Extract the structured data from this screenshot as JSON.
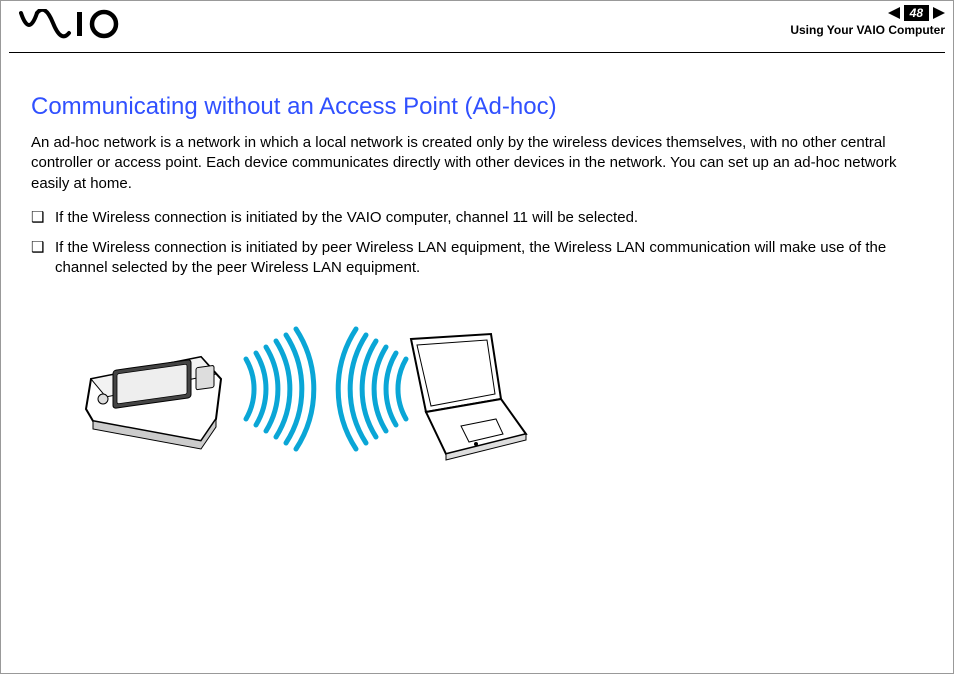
{
  "header": {
    "page_number": "48",
    "section": "Using Your VAIO Computer"
  },
  "content": {
    "heading": "Communicating without an Access Point (Ad-hoc)",
    "intro": "An ad-hoc network is a network in which a local network is created only by the wireless devices themselves, with no other central controller or access point. Each device communicates directly with other devices in the network. You can set up an ad-hoc network easily at home.",
    "bullets": [
      "If the Wireless connection is initiated by the VAIO computer, channel 11 will be selected.",
      "If the Wireless connection is initiated by peer Wireless LAN equipment, the Wireless LAN communication will make use of the channel selected by the peer Wireless LAN equipment."
    ]
  }
}
